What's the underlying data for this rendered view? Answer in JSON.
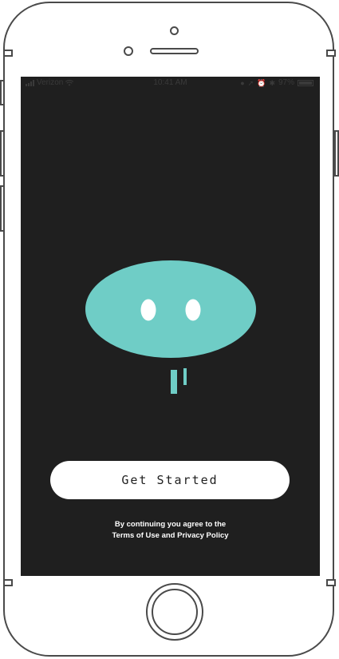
{
  "status_bar": {
    "carrier": "Verizon",
    "time": "10:41 AM",
    "battery_percent": "97%",
    "battery_level": 0.97,
    "icons": [
      "signal-icon",
      "wifi-icon",
      "location-icon",
      "alarm-icon",
      "bluetooth-icon",
      "battery-icon"
    ]
  },
  "mascot": {
    "icon": "blob-face-icon",
    "body_color": "#6fcdc6",
    "eye_color": "#ffffff"
  },
  "main": {
    "get_started_label": "Get Started"
  },
  "legal": {
    "line1": "By continuing you agree to the",
    "terms_link": "Terms of Use",
    "and_text": " and ",
    "privacy_link": "Privacy Policy"
  },
  "colors": {
    "screen_background": "#1f1f1f",
    "button_background": "#ffffff",
    "button_text": "#1f1f1f",
    "frame": "#4a4a4a"
  }
}
